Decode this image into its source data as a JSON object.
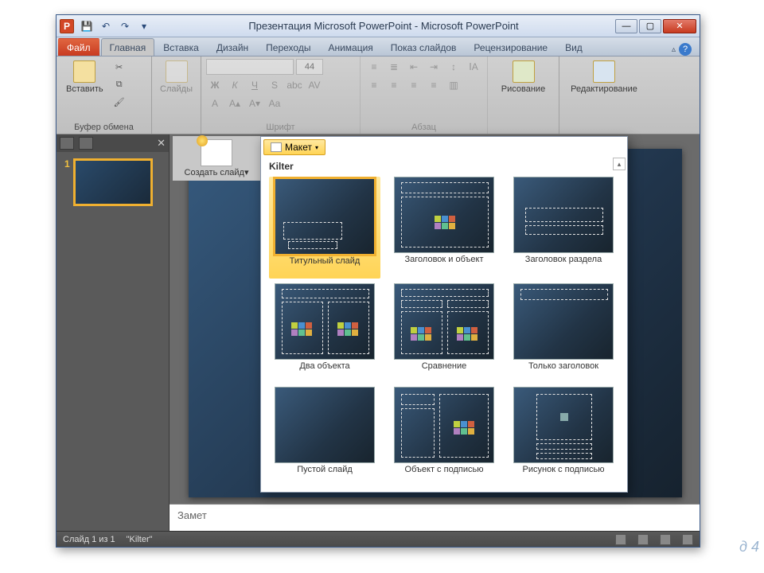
{
  "title": "Презентация Microsoft PowerPoint - Microsoft PowerPoint",
  "app_letter": "P",
  "tabs": {
    "file": "Файл",
    "items": [
      "Главная",
      "Вставка",
      "Дизайн",
      "Переходы",
      "Анимация",
      "Показ слайдов",
      "Рецензирование",
      "Вид"
    ],
    "active": 0
  },
  "ribbon": {
    "clipboard": {
      "paste": "Вставить",
      "label": "Буфер обмена"
    },
    "slides": {
      "label": "Слайды"
    },
    "font": {
      "label": "Шрифт",
      "size": "44"
    },
    "paragraph": {
      "label": "Абзац"
    },
    "drawing": {
      "btn": "Рисование",
      "label": ""
    },
    "editing": {
      "btn": "Редактирование",
      "label": ""
    }
  },
  "newslide": {
    "label": "Создать слайд",
    "dropdown": "▾"
  },
  "gallery": {
    "button": "Макет",
    "section": "Kilter",
    "items": [
      "Титульный слайд",
      "Заголовок и объект",
      "Заголовок раздела",
      "Два объекта",
      "Сравнение",
      "Только заголовок",
      "Пустой слайд",
      "Объект с подписью",
      "Рисунок с подписью"
    ],
    "selected": 0
  },
  "thumb": {
    "num": "1"
  },
  "notes": "Замет",
  "status": {
    "slide": "Слайд 1 из 1",
    "theme": "\"Kilter\""
  },
  "corner": "д 4"
}
